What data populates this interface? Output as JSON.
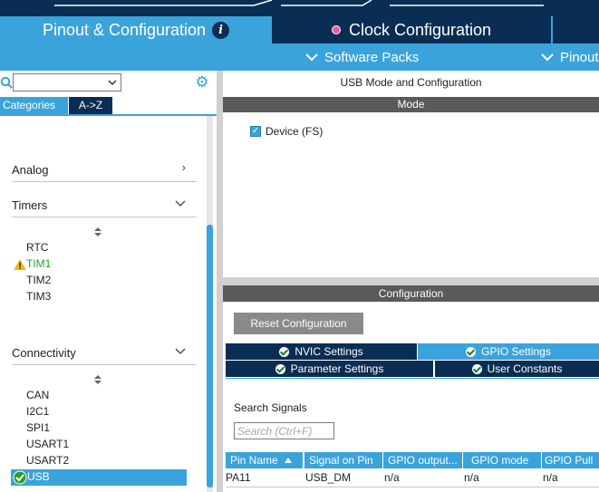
{
  "header": {
    "tabs": [
      {
        "label": "Pinout & Configuration",
        "active": true,
        "info_icon": "i"
      },
      {
        "label": "Clock Configuration",
        "active": false
      }
    ]
  },
  "subnav": {
    "items": [
      {
        "label": "Software Packs"
      },
      {
        "label": "Pinout"
      }
    ]
  },
  "left_panel": {
    "search_placeholder": "",
    "tabs": [
      {
        "label": "Categories",
        "active": true
      },
      {
        "label": "A->Z",
        "active": false
      }
    ],
    "groups": [
      {
        "label": "Analog",
        "expanded": false,
        "items": []
      },
      {
        "label": "Timers",
        "expanded": true,
        "items": [
          {
            "label": "RTC",
            "status": "none"
          },
          {
            "label": "TIM1",
            "status": "warning"
          },
          {
            "label": "TIM2",
            "status": "none"
          },
          {
            "label": "TIM3",
            "status": "none"
          }
        ]
      },
      {
        "label": "Connectivity",
        "expanded": true,
        "items": [
          {
            "label": "CAN",
            "status": "none"
          },
          {
            "label": "I2C1",
            "status": "none"
          },
          {
            "label": "SPI1",
            "status": "none"
          },
          {
            "label": "USART1",
            "status": "none"
          },
          {
            "label": "USART2",
            "status": "none"
          },
          {
            "label": "USB",
            "status": "ok",
            "selected": true
          }
        ]
      }
    ]
  },
  "main": {
    "title": "USB Mode and Configuration",
    "mode_header": "Mode",
    "mode": {
      "device_label": "Device (FS)",
      "device_checked": true
    },
    "config_header": "Configuration",
    "reset_button": "Reset Configuration",
    "config_tabs": [
      {
        "label": "NVIC Settings",
        "active": false
      },
      {
        "label": "GPIO Settings",
        "active": true
      },
      {
        "label": "Parameter Settings",
        "active": false
      },
      {
        "label": "User Constants",
        "active": false
      }
    ],
    "search_signals_label": "Search Signals",
    "search_signals_placeholder": "Search (Ctrl+F)",
    "table": {
      "columns": [
        "Pin Name",
        "Signal on Pin",
        "GPIO output...",
        "GPIO mode",
        "GPIO Pull"
      ],
      "rows": [
        [
          "PA11",
          "USB_DM",
          "n/a",
          "n/a",
          "n/a"
        ]
      ]
    }
  },
  "colors": {
    "navy": "#0a2d53",
    "accent_blue": "#3aa3db",
    "warning": "#f2b90f",
    "ok_green": "#2e9d2e"
  },
  "icons": [
    "info-icon",
    "clock-dot-icon",
    "chevron-down-icon",
    "search-icon",
    "gear-icon",
    "chevron-right-icon",
    "sort-icon",
    "warning-icon",
    "check-circle-icon",
    "checkbox-icon",
    "sort-ascending-icon"
  ]
}
